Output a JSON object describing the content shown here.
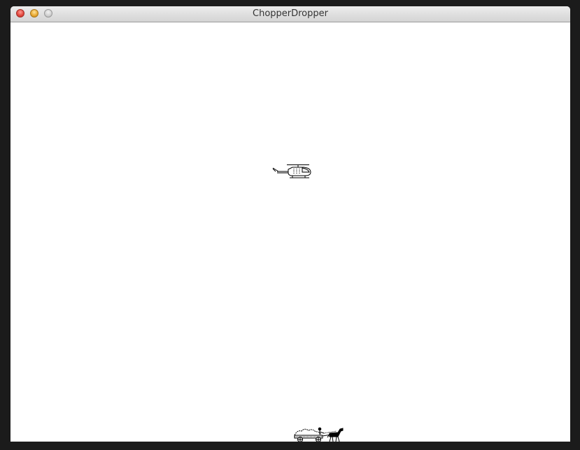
{
  "window": {
    "title": "ChopperDropper"
  },
  "game": {
    "sprites": [
      {
        "name": "helicopter",
        "icon": "helicopter-icon"
      },
      {
        "name": "horse-cart",
        "icon": "horse-cart-icon"
      }
    ]
  }
}
